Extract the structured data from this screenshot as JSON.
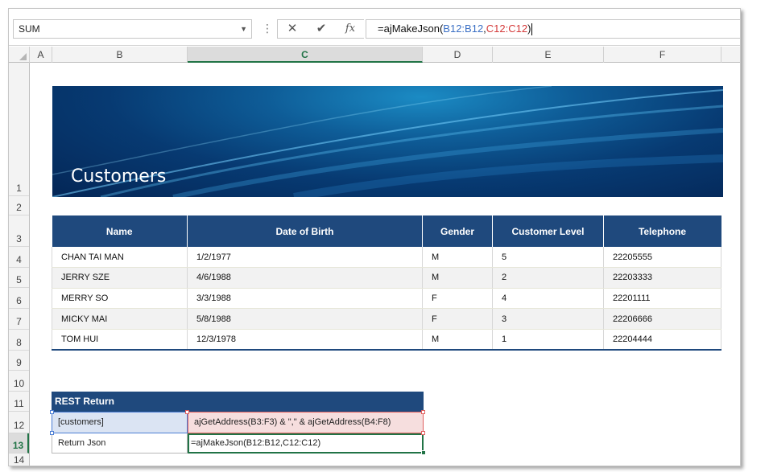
{
  "formula_bar": {
    "name_box": "SUM",
    "cancel_icon": "x-icon",
    "enter_icon": "check-icon",
    "fx_label": "fx",
    "formula_prefix": "=ajMakeJson(",
    "formula_ref1": "B12:B12",
    "formula_sep": ",",
    "formula_ref2": "C12:C12",
    "formula_suffix": ")"
  },
  "columns": [
    "A",
    "B",
    "C",
    "D",
    "E",
    "F"
  ],
  "selected_column": "C",
  "rows": [
    "1",
    "2",
    "3",
    "4",
    "5",
    "6",
    "7",
    "8",
    "9",
    "10",
    "11",
    "12",
    "13",
    "14"
  ],
  "selected_row": "13",
  "banner": {
    "title": "Customers"
  },
  "customers_table": {
    "headers": [
      "Name",
      "Date of Birth",
      "Gender",
      "Customer Level",
      "Telephone"
    ],
    "rows": [
      [
        "CHAN TAI MAN",
        "1/2/1977",
        "M",
        "5",
        "22205555"
      ],
      [
        "JERRY SZE",
        "4/6/1988",
        "M",
        "2",
        "22203333"
      ],
      [
        "MERRY SO",
        "3/3/1988",
        "F",
        "4",
        "22201111"
      ],
      [
        "MICKY MAI",
        "5/8/1988",
        "F",
        "3",
        "22206666"
      ],
      [
        "TOM HUI",
        "12/3/1978",
        "M",
        "1",
        "22204444"
      ]
    ]
  },
  "rest": {
    "header": "REST Return",
    "b12": "[customers]",
    "c12": "ajGetAddress(B3:F3) & \",\" & ajGetAddress(B4:F8)",
    "b13": "Return Json",
    "c13": "=ajMakeJson(B12:B12,C12:C12)"
  },
  "colors": {
    "header_blue": "#1f497d",
    "excel_green": "#217346",
    "ref_blue": "#3a6fc4",
    "ref_red": "#d43a3a"
  }
}
